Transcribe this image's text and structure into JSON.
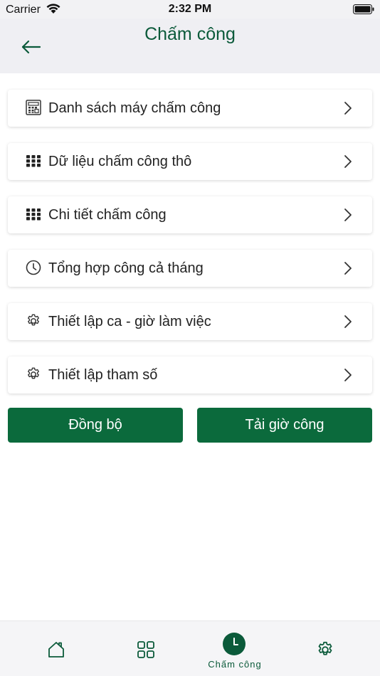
{
  "status_bar": {
    "carrier": "Carrier",
    "time": "2:32 PM"
  },
  "header": {
    "title": "Chấm công",
    "back_icon": "arrow-left-icon"
  },
  "menu": {
    "items": [
      {
        "label": "Danh sách máy chấm công",
        "icon": "device-list-icon"
      },
      {
        "label": "Dữ liệu chấm công thô",
        "icon": "grid-icon"
      },
      {
        "label": "Chi tiết chấm công",
        "icon": "grid-icon"
      },
      {
        "label": "Tổng hợp công cả tháng",
        "icon": "clock-icon"
      },
      {
        "label": "Thiết lập ca - giờ làm việc",
        "icon": "gear-icon"
      },
      {
        "label": "Thiết lập tham số",
        "icon": "gear-icon"
      }
    ]
  },
  "actions": {
    "sync_label": "Đồng bộ",
    "load_hours_label": "Tải giờ công"
  },
  "tabbar": {
    "tabs": [
      {
        "icon": "home-icon",
        "label": ""
      },
      {
        "icon": "apps-grid-icon",
        "label": ""
      },
      {
        "icon": "clock-icon",
        "label": "Chấm công",
        "active": true
      },
      {
        "icon": "gear-icon",
        "label": ""
      }
    ]
  },
  "colors": {
    "primary": "#0b6a3c",
    "primary_dark": "#0b5a3a",
    "header_bg": "#efeff3"
  }
}
